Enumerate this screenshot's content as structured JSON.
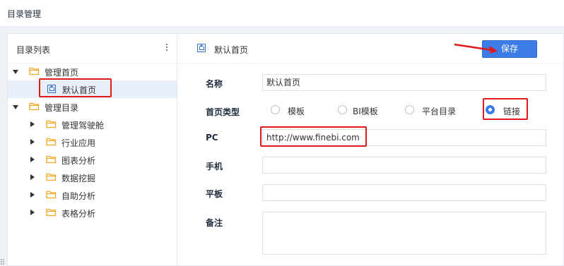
{
  "header": {
    "title": "目录管理"
  },
  "left_panel": {
    "title": "目录列表",
    "more_icon": "more-vertical-icon",
    "tree": [
      {
        "label": "管理首页",
        "expanded": true
      },
      {
        "label": "默认首页",
        "selected": true,
        "icon": "home-icon"
      },
      {
        "label": "管理目录",
        "expanded": true
      },
      {
        "label": "管理驾驶舱"
      },
      {
        "label": "行业应用"
      },
      {
        "label": "图表分析"
      },
      {
        "label": "数据挖掘"
      },
      {
        "label": "自助分析"
      },
      {
        "label": "表格分析"
      }
    ]
  },
  "right_panel": {
    "title": "默认首页",
    "save_label": "保存",
    "form": {
      "name_label": "名称",
      "name_value": "默认首页",
      "type_label": "首页类型",
      "type_options": [
        "模板",
        "BI模板",
        "平台目录",
        "链接"
      ],
      "type_selected": "链接",
      "pc_label": "PC",
      "pc_value": "http://www.finebi.com",
      "phone_label": "手机",
      "phone_value": "",
      "tablet_label": "平板",
      "tablet_value": "",
      "note_label": "备注",
      "note_value": ""
    }
  },
  "colors": {
    "accent": "#3b7ce6",
    "highlight": "#e01a1a",
    "folder": "#f5a623"
  }
}
